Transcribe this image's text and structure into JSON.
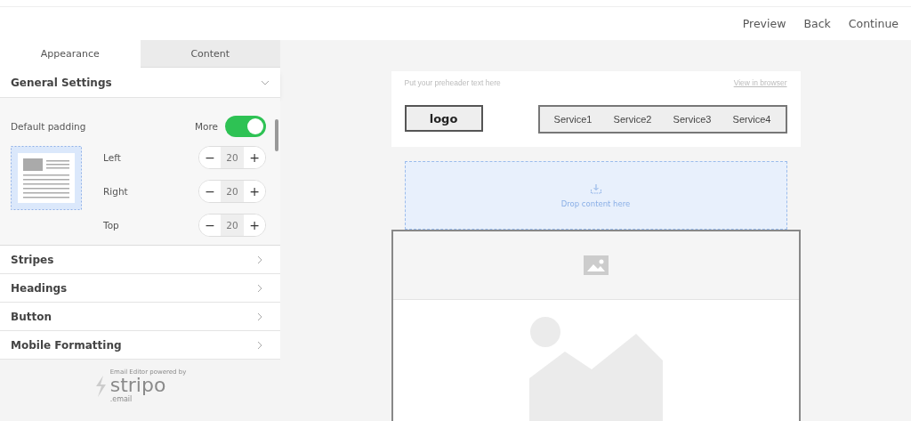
{
  "top_bar": {
    "actions": [
      "Preview",
      "Back",
      "Continue"
    ]
  },
  "tabs": [
    {
      "label": "Appearance",
      "selected": true
    },
    {
      "label": "Content",
      "selected": false
    }
  ],
  "general_settings": {
    "title": "General Settings",
    "expanded": true,
    "padding_label": "Default padding",
    "toggle": {
      "label": "More",
      "on": true
    },
    "paddings": [
      {
        "label": "Left",
        "value": "20",
        "minus": "−",
        "plus": "+"
      },
      {
        "label": "Right",
        "value": "20",
        "minus": "−",
        "plus": "+"
      },
      {
        "label": "Top",
        "value": "20",
        "minus": "−",
        "plus": "+"
      }
    ]
  },
  "sections": [
    {
      "label": "Stripes",
      "expanded": false
    },
    {
      "label": "Headings",
      "expanded": false
    },
    {
      "label": "Button",
      "expanded": false
    },
    {
      "label": "Mobile Formatting",
      "expanded": false
    }
  ],
  "branding": {
    "caption": "Email Editor powered by",
    "name": "stripo",
    "suffix": ".email"
  },
  "email": {
    "preheader": "Put your preheader text here",
    "view_link": "View in browser",
    "logo": "logo",
    "menu": [
      "Service1",
      "Service2",
      "Service3",
      "Service4"
    ],
    "drop_zone": "Drop content here"
  }
}
